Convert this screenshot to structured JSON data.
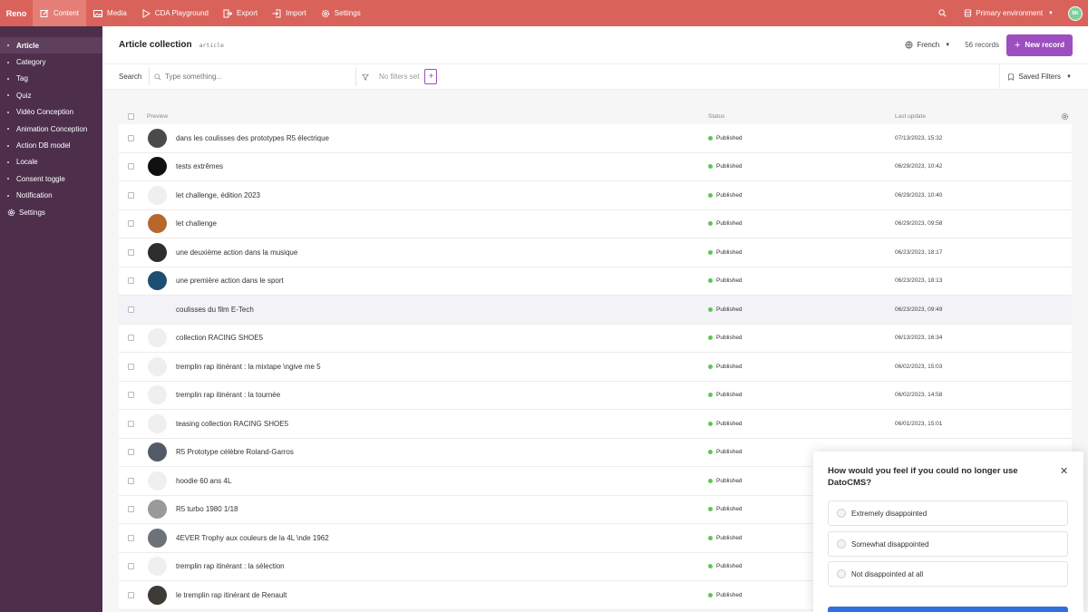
{
  "topbar": {
    "brand": "Reno",
    "nav": [
      {
        "label": "Content",
        "icon": "edit-icon",
        "active": true
      },
      {
        "label": "Media",
        "icon": "image-icon",
        "active": false
      },
      {
        "label": "CDA Playground",
        "icon": "play-icon",
        "active": false
      },
      {
        "label": "Export",
        "icon": "export-icon",
        "active": false
      },
      {
        "label": "Import",
        "icon": "import-icon",
        "active": false
      },
      {
        "label": "Settings",
        "icon": "gear-icon",
        "active": false
      }
    ],
    "environment": "Primary environment",
    "avatar_initials": "BK",
    "accent_color": "#d9635b"
  },
  "sidebar": {
    "items": [
      {
        "label": "Article",
        "active": true
      },
      {
        "label": "Category"
      },
      {
        "label": "Tag"
      },
      {
        "label": "Quiz"
      },
      {
        "label": "Vidéo Conception"
      },
      {
        "label": "Animation Conception"
      },
      {
        "label": "Action DB model"
      },
      {
        "label": "Locale"
      },
      {
        "label": "Consent toggle"
      },
      {
        "label": "Notification"
      }
    ],
    "settings_label": "Settings"
  },
  "header": {
    "title": "Article collection",
    "api_key": "article",
    "locale": "French",
    "records": "56 records",
    "new_record": "New record",
    "button_color": "#9d4fbf"
  },
  "filters": {
    "search_label": "Search",
    "search_placeholder": "Type something...",
    "no_filters": "No filters set",
    "saved_filters": "Saved Filters"
  },
  "table": {
    "columns": {
      "preview": "Preview",
      "status": "Status",
      "last_update": "Last update"
    },
    "rows": [
      {
        "title": "dans les coulisses des prototypes R5 électrique",
        "status": "Published",
        "updated": "07/13/2023, 15:32",
        "thumb": "#4a4a4a"
      },
      {
        "title": "tests extrêmes",
        "status": "Published",
        "updated": "06/29/2023, 10:42",
        "thumb": "#111111"
      },
      {
        "title": "let challenge, édition 2023",
        "status": "Published",
        "updated": "06/29/2023, 10:40",
        "thumb": ""
      },
      {
        "title": "let challenge",
        "status": "Published",
        "updated": "06/29/2023, 09:58",
        "thumb": "#b5672e"
      },
      {
        "title": "une deuxième action dans la musique",
        "status": "Published",
        "updated": "06/23/2023, 18:17",
        "thumb": "#2d2d2d"
      },
      {
        "title": "une première action dans le sport",
        "status": "Published",
        "updated": "06/23/2023, 18:13",
        "thumb": "#1f4e73"
      },
      {
        "title": "coulisses du film E-Tech",
        "status": "Published",
        "updated": "06/23/2023, 09:49",
        "thumb": "none"
      },
      {
        "title": "collection RACING SHOE5",
        "status": "Published",
        "updated": "06/13/2023, 16:34",
        "thumb": ""
      },
      {
        "title": "tremplin rap itinérant : la mixtape \\ngive me 5",
        "status": "Published",
        "updated": "06/02/2023, 15:03",
        "thumb": ""
      },
      {
        "title": "tremplin rap itinérant : la tournée",
        "status": "Published",
        "updated": "06/02/2023, 14:58",
        "thumb": ""
      },
      {
        "title": "teasing collection RACING SHOE5",
        "status": "Published",
        "updated": "06/01/2023, 15:01",
        "thumb": ""
      },
      {
        "title": "R5 Prototype célèbre Roland-Garros",
        "status": "Published",
        "updated": "",
        "thumb": "#555b66"
      },
      {
        "title": "hoodie 60 ans 4L",
        "status": "Published",
        "updated": "",
        "thumb": ""
      },
      {
        "title": "R5 turbo 1980 1/18",
        "status": "Published",
        "updated": "",
        "thumb": "#9a9a9a"
      },
      {
        "title": "4EVER Trophy aux couleurs de la 4L \\nde 1962",
        "status": "Published",
        "updated": "",
        "thumb": "#6d7178"
      },
      {
        "title": "tremplin rap itinérant : la sélection",
        "status": "Published",
        "updated": "",
        "thumb": ""
      },
      {
        "title": "le tremplin rap itinérant de Renault",
        "status": "Published",
        "updated": "",
        "thumb": "#3e3a35"
      }
    ],
    "status_color": "#61c554"
  },
  "survey": {
    "question": "How would you feel if you could no longer use DatoCMS?",
    "options": [
      "Extremely disappointed",
      "Somewhat disappointed",
      "Not disappointed at all"
    ],
    "button_color": "#2f6fe0"
  }
}
